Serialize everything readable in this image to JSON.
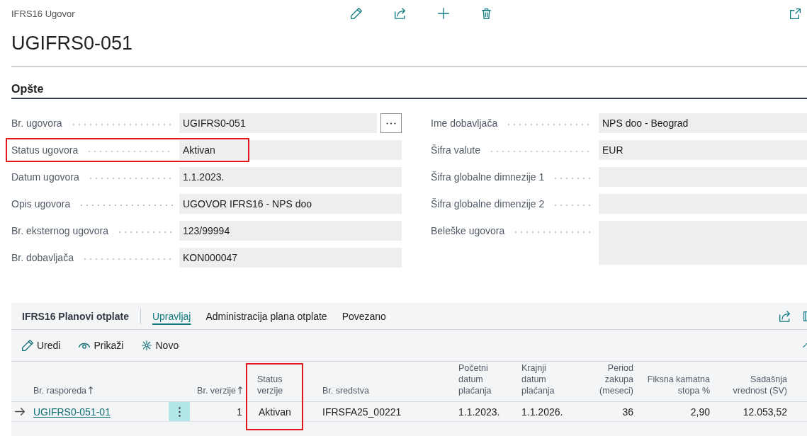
{
  "page": {
    "caption": "IFRS16 Ugovor",
    "title": "UGIFRS0-051"
  },
  "general": {
    "title": "Opšte",
    "left_fields": [
      {
        "label": "Br. ugovora",
        "value": "UGIFRS0-051",
        "kind": "lookup",
        "highlighted": false
      },
      {
        "label": "Status ugovora",
        "value": "Aktivan",
        "kind": "text",
        "highlighted": true
      },
      {
        "label": "Datum ugovora",
        "value": "1.1.2023.",
        "kind": "text",
        "highlighted": false
      },
      {
        "label": "Opis ugovora",
        "value": "UGOVOR IFRS16 - NPS doo",
        "kind": "text",
        "highlighted": false
      },
      {
        "label": "Br. eksternog ugovora",
        "value": "123/99994",
        "kind": "text",
        "highlighted": false
      },
      {
        "label": "Br. dobavljača",
        "value": "KON000047",
        "kind": "text",
        "highlighted": false
      }
    ],
    "right_fields": [
      {
        "label": "Ime dobavljača",
        "value": "NPS doo - Beograd",
        "kind": "text",
        "highlighted": false
      },
      {
        "label": "Šifra valute",
        "value": "EUR",
        "kind": "text",
        "highlighted": false
      },
      {
        "label": "Šifra globalne dimnezije 1",
        "kind": "text",
        "highlighted": false
      },
      {
        "label": "Šifra globalne dimenzije 2",
        "kind": "text",
        "highlighted": false
      },
      {
        "label": "Beleške ugovora",
        "kind": "note",
        "highlighted": false
      }
    ]
  },
  "subpage": {
    "title": "IFRS16 Planovi otplate",
    "tabs": [
      {
        "label": "Upravljaj",
        "selected": true
      },
      {
        "label": "Administracija plana otplate",
        "selected": false
      },
      {
        "label": "Povezano",
        "selected": false
      }
    ],
    "actions": [
      {
        "label": "Uredi"
      },
      {
        "label": "Prikaži"
      },
      {
        "label": "Novo"
      }
    ],
    "table": {
      "columns": [
        {
          "label": "Br. rasporeda",
          "sorted": true,
          "highlighted": false
        },
        {
          "label": "Br. verzije",
          "sorted": true,
          "highlighted": false
        },
        {
          "label": "Status verzije",
          "sorted": false,
          "highlighted": true
        },
        {
          "label": "Br. sredstva",
          "sorted": false,
          "highlighted": false
        },
        {
          "label": "Početni datum plaćanja",
          "sorted": false,
          "highlighted": false
        },
        {
          "label": "Krajnji datum plaćanja",
          "sorted": false,
          "highlighted": false
        },
        {
          "label": "Period zakupa (meseci)",
          "sorted": false,
          "highlighted": false
        },
        {
          "label": "Fiksna kamatna stopa %",
          "sorted": false,
          "highlighted": false
        },
        {
          "label": "Sadašnja vrednost (SV)",
          "sorted": false,
          "highlighted": false
        }
      ],
      "rows": [
        {
          "current": true,
          "cells": [
            "UGIFRS0-051-01",
            "1",
            "Aktivan",
            "IFRSFA25_00221",
            "1.1.2023.",
            "1.1.2026.",
            "36",
            "2,90",
            "12.053,52"
          ]
        }
      ]
    }
  }
}
